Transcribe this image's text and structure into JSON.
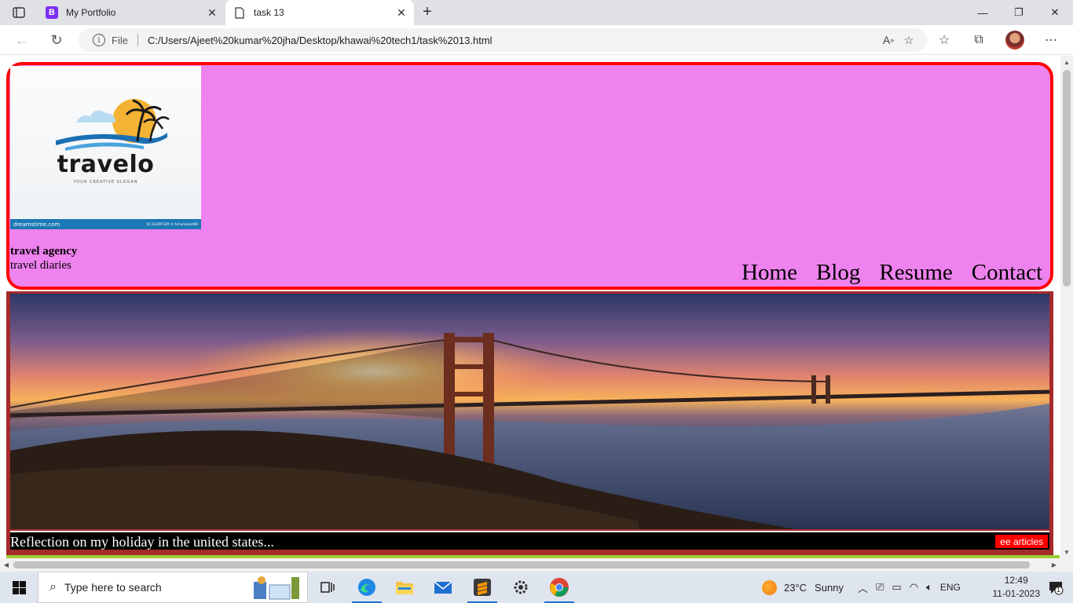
{
  "browser": {
    "tabs": [
      {
        "title": "My Portfolio",
        "favicon_letter": "B",
        "active": false
      },
      {
        "title": "task 13",
        "active": true
      }
    ],
    "address": {
      "scheme_label": "File",
      "url": "C:/Users/Ajeet%20kumar%20jha/Desktop/khawai%20tech1/task%2013.html"
    }
  },
  "page": {
    "logo": {
      "name": "travelo",
      "slogan": "YOUR CREATIVE SLOGAN",
      "watermark_left": "dreamstime.com",
      "watermark_right": "ID 212897349 © Anhamasket89"
    },
    "brand_title": "travel agency",
    "brand_subtitle": "travel diaries",
    "nav": [
      "Home",
      "Blog",
      "Resume",
      "Contact"
    ],
    "hero": {
      "caption": "Reflection on my holiday in the united states...",
      "link": "ee articles"
    },
    "colors": {
      "header_bg": "#ee82ee",
      "header_border": "#ff0000",
      "hero_border": "#a52a2a",
      "link_bg": "#ff0000",
      "bottom_line": "#9acd32"
    }
  },
  "taskbar": {
    "search_placeholder": "Type here to search",
    "weather": {
      "temp": "23°C",
      "condition": "Sunny"
    },
    "language": "ENG",
    "time": "12:49",
    "date": "11-01-2023",
    "notification_count": "1"
  }
}
